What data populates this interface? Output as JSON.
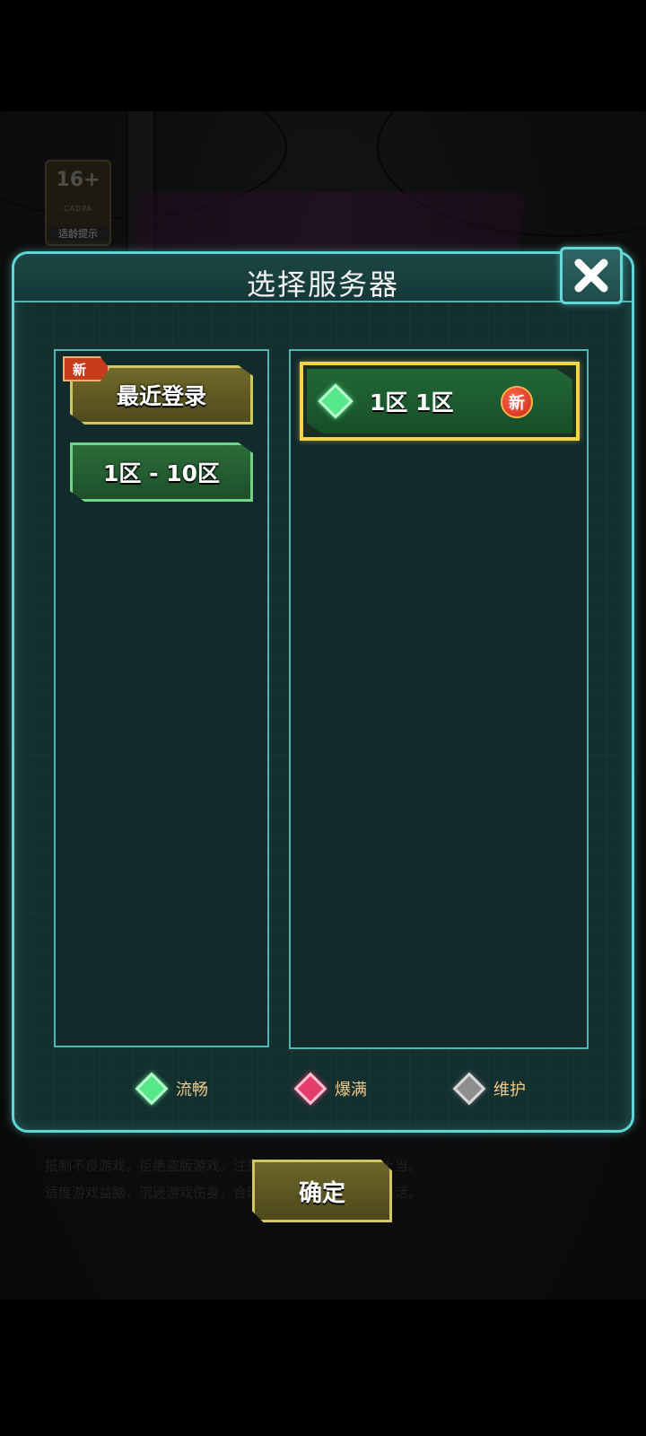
{
  "background": {
    "age_badge": {
      "number": "16+",
      "sub": "CADPA",
      "text": "适龄提示"
    },
    "notice_lines": [
      "抵制不良游戏，拒绝盗版游戏。注意自我保护，谨防受骗上当。",
      "适度游戏益脑，沉迷游戏伤身。合理安排时间，享受健康生活。"
    ]
  },
  "dialog": {
    "title": "选择服务器",
    "close_icon": "close-x-icon",
    "categories": [
      {
        "label": "最近登录",
        "badge": "新",
        "style": "gold"
      },
      {
        "label": "1区 - 10区",
        "badge": "",
        "style": "green"
      }
    ],
    "servers": [
      {
        "name": "1区 1区",
        "status": "green",
        "badge": "新",
        "selected": true
      }
    ],
    "legend": [
      {
        "label": "流畅",
        "color": "#57e88a"
      },
      {
        "label": "爆满",
        "color": "#e33d6c"
      },
      {
        "label": "维护",
        "color": "#8e8e8e"
      }
    ]
  },
  "confirm_button": {
    "label": "确定"
  }
}
